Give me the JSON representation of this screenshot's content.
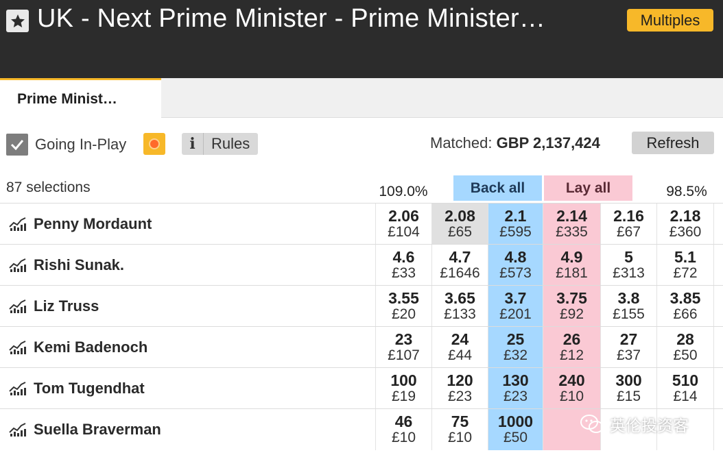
{
  "header": {
    "title": "UK - Next Prime Minister - Prime Minister…",
    "multiples_label": "Multiples"
  },
  "tabs": [
    {
      "label": "Prime Minist…",
      "active": true
    }
  ],
  "toolbar": {
    "going_inplay_label": "Going In-Play",
    "going_inplay_checked": true,
    "info_label": "i",
    "rules_label": "Rules",
    "matched_label": "Matched:",
    "matched_value": "GBP 2,137,424",
    "refresh_label": "Refresh"
  },
  "market": {
    "selections_text": "87 selections",
    "back_overround": "109.0%",
    "lay_overround": "98.5%",
    "back_all_label": "Back all",
    "lay_all_label": "Lay all",
    "colors": {
      "back": "#a6d8ff",
      "lay": "#fac9d4",
      "brand": "#f7b829",
      "header_bg": "#2c2c2c"
    }
  },
  "runners": [
    {
      "name": "Penny Mordaunt",
      "prices": [
        {
          "price": "2.06",
          "size": "£104"
        },
        {
          "price": "2.08",
          "size": "£65"
        },
        {
          "price": "2.1",
          "size": "£595"
        },
        {
          "price": "2.14",
          "size": "£335"
        },
        {
          "price": "2.16",
          "size": "£67"
        },
        {
          "price": "2.18",
          "size": "£360"
        }
      ]
    },
    {
      "name": "Rishi Sunak.",
      "prices": [
        {
          "price": "4.6",
          "size": "£33"
        },
        {
          "price": "4.7",
          "size": "£1646"
        },
        {
          "price": "4.8",
          "size": "£573"
        },
        {
          "price": "4.9",
          "size": "£181"
        },
        {
          "price": "5",
          "size": "£313"
        },
        {
          "price": "5.1",
          "size": "£72"
        }
      ]
    },
    {
      "name": "Liz Truss",
      "prices": [
        {
          "price": "3.55",
          "size": "£20"
        },
        {
          "price": "3.65",
          "size": "£133"
        },
        {
          "price": "3.7",
          "size": "£201"
        },
        {
          "price": "3.75",
          "size": "£92"
        },
        {
          "price": "3.8",
          "size": "£155"
        },
        {
          "price": "3.85",
          "size": "£66"
        }
      ]
    },
    {
      "name": "Kemi Badenoch",
      "prices": [
        {
          "price": "23",
          "size": "£107"
        },
        {
          "price": "24",
          "size": "£44"
        },
        {
          "price": "25",
          "size": "£32"
        },
        {
          "price": "26",
          "size": "£12"
        },
        {
          "price": "27",
          "size": "£37"
        },
        {
          "price": "28",
          "size": "£50"
        }
      ]
    },
    {
      "name": "Tom Tugendhat",
      "prices": [
        {
          "price": "100",
          "size": "£19"
        },
        {
          "price": "120",
          "size": "£23"
        },
        {
          "price": "130",
          "size": "£23"
        },
        {
          "price": "240",
          "size": "£10"
        },
        {
          "price": "300",
          "size": "£15"
        },
        {
          "price": "510",
          "size": "£14"
        }
      ]
    },
    {
      "name": "Suella Braverman",
      "prices": [
        {
          "price": "46",
          "size": "£10"
        },
        {
          "price": "75",
          "size": "£10"
        },
        {
          "price": "1000",
          "size": "£50"
        },
        {
          "price": "",
          "size": ""
        },
        {
          "price": "",
          "size": ""
        },
        {
          "price": "",
          "size": ""
        }
      ]
    }
  ],
  "watermark": {
    "text": "英伦投资客"
  }
}
